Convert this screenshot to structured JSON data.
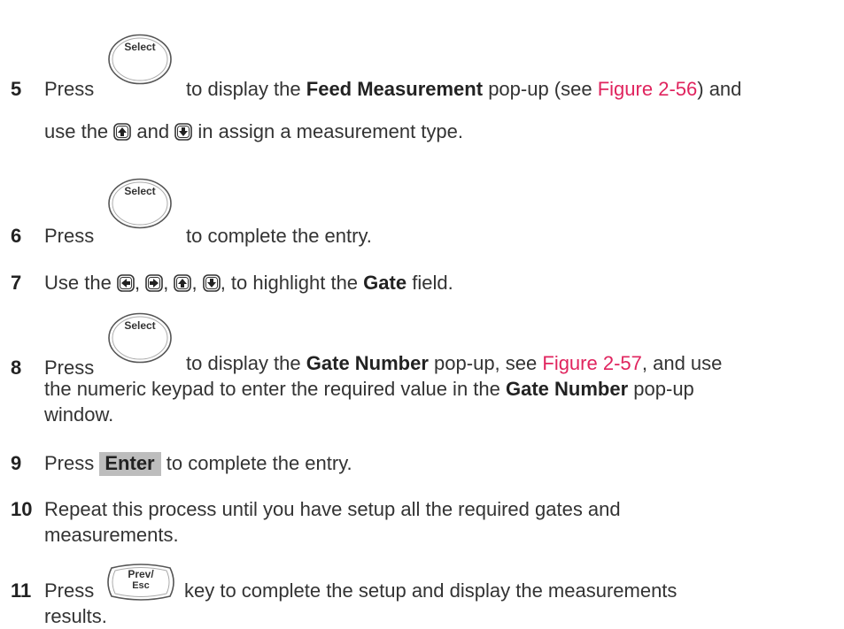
{
  "keys": {
    "select_label": "Select",
    "prev_esc_line1": "Prev/",
    "prev_esc_line2": "Esc",
    "enter_label": "Enter"
  },
  "steps": {
    "s5": {
      "num": "5",
      "press": "Press",
      "t1": "to display the",
      "b1": "Feed Measurement",
      "t2": "pop-up (see",
      "link": "Figure 2-56",
      "t3": ") and",
      "t4": "use the",
      "t5": "and",
      "t6": "in assign a measurement type."
    },
    "s6": {
      "num": "6",
      "press": "Press",
      "t1": "to complete the entry."
    },
    "s7": {
      "num": "7",
      "t1": "Use the",
      "sep": ",",
      "t2": ", to highlight the",
      "b1": "Gate",
      "t3": "field."
    },
    "s8": {
      "num": "8",
      "press": "Press",
      "t1": "to display the",
      "b1": "Gate Number",
      "t2": "pop-up, see",
      "link": "Figure 2-57",
      "t3": ", and use",
      "l2": "the numeric keypad to enter the required value in the",
      "b2": "Gate Number",
      "t4": "pop-up",
      "l3": "window."
    },
    "s9": {
      "num": "9",
      "press": "Press",
      "t1": "to complete the entry."
    },
    "s10": {
      "num": "10",
      "l1": "Repeat this process until you have setup all the required gates and",
      "l2": "measurements."
    },
    "s11": {
      "num": "11",
      "press": "Press",
      "t1": "key to complete the setup and display the measurements",
      "l2": "results."
    }
  }
}
